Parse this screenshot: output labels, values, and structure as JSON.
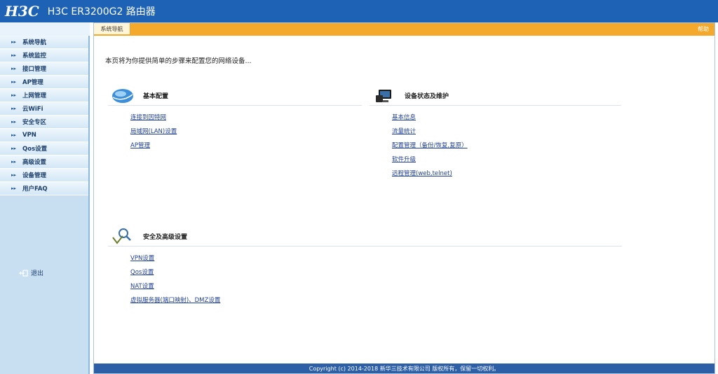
{
  "header": {
    "logo": "H3C",
    "product": "H3C ER3200G2 路由器"
  },
  "sidebar": {
    "items": [
      {
        "label": "系统导航"
      },
      {
        "label": "系统监控"
      },
      {
        "label": "接口管理"
      },
      {
        "label": "AP管理"
      },
      {
        "label": "上网管理"
      },
      {
        "label": "云WiFi"
      },
      {
        "label": "安全专区"
      },
      {
        "label": "VPN"
      },
      {
        "label": "Qos设置"
      },
      {
        "label": "高级设置"
      },
      {
        "label": "设备管理"
      },
      {
        "label": "用户FAQ"
      }
    ],
    "logout": "退出"
  },
  "main": {
    "tab": "系统导航",
    "help": "帮助",
    "intro": "本页将为你提供简单的步骤来配置您的网络设备...",
    "sections": {
      "basic": {
        "title": "基本配置",
        "links": [
          "连接到因特网",
          "局域网(LAN)设置",
          "AP管理"
        ]
      },
      "status": {
        "title": "设备状态及维护",
        "links": [
          "基本信息",
          "流量统计",
          "配置管理（备份/恢复,复原）",
          "软件升级",
          "远程管理(web,telnet)"
        ]
      },
      "security": {
        "title": "安全及高级设置",
        "links": [
          "VPN设置",
          "Qos设置",
          "NAT设置",
          "虚拟服务器(端口映射)、DMZ设置"
        ]
      }
    },
    "footer": "Copyright (c) 2014-2018 新华三技术有限公司 版权所有，保留一切权利。"
  }
}
